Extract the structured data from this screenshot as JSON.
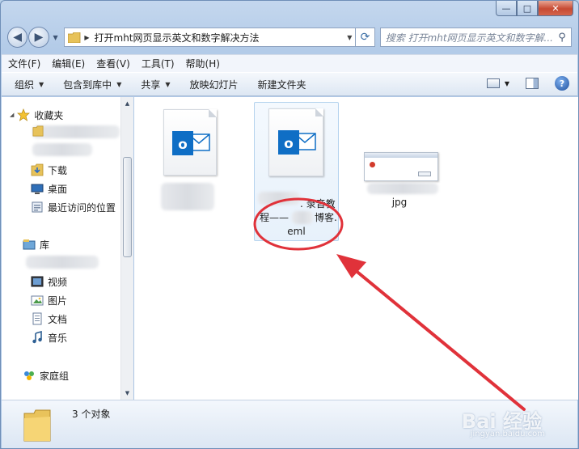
{
  "window": {
    "caption_buttons": [
      "—",
      "□",
      "✕"
    ]
  },
  "address": {
    "path": "打开mht网页显示英文和数字解决方法",
    "search_placeholder": "搜索 打开mht网页显示英文和数字解..."
  },
  "menubar": {
    "items": [
      "文件(F)",
      "编辑(E)",
      "查看(V)",
      "工具(T)",
      "帮助(H)"
    ]
  },
  "toolbar": {
    "items": [
      "组织",
      "包含到库中",
      "共享",
      "放映幻灯片",
      "新建文件夹"
    ]
  },
  "navpane": {
    "favorites_label": "收藏夹",
    "favorites": [
      "下载",
      "桌面",
      "最近访问的位置"
    ],
    "library_label": "库",
    "libraries": [
      "视频",
      "图片",
      "文档",
      "音乐"
    ],
    "homegroup_label": "家庭组"
  },
  "files": [
    {
      "name_visible": "",
      "type_icon": "outlook-eml-icon"
    },
    {
      "name_line1": ". 录音教",
      "name_line2": "程——",
      "name_line2b": "博客.",
      "name_line3": "eml",
      "type_icon": "outlook-eml-icon",
      "selected": true
    },
    {
      "name_visible": "jpg",
      "type_icon": "image-thumbnail"
    }
  ],
  "status": {
    "count": "3 个对象"
  },
  "watermark": {
    "logo": "Bai 经验",
    "url": "jingyan.baidu.com"
  },
  "colors": {
    "annotation_red": "#e0323a",
    "selection": "#e7f1fb",
    "outlook_blue": "#0f6ec5"
  }
}
